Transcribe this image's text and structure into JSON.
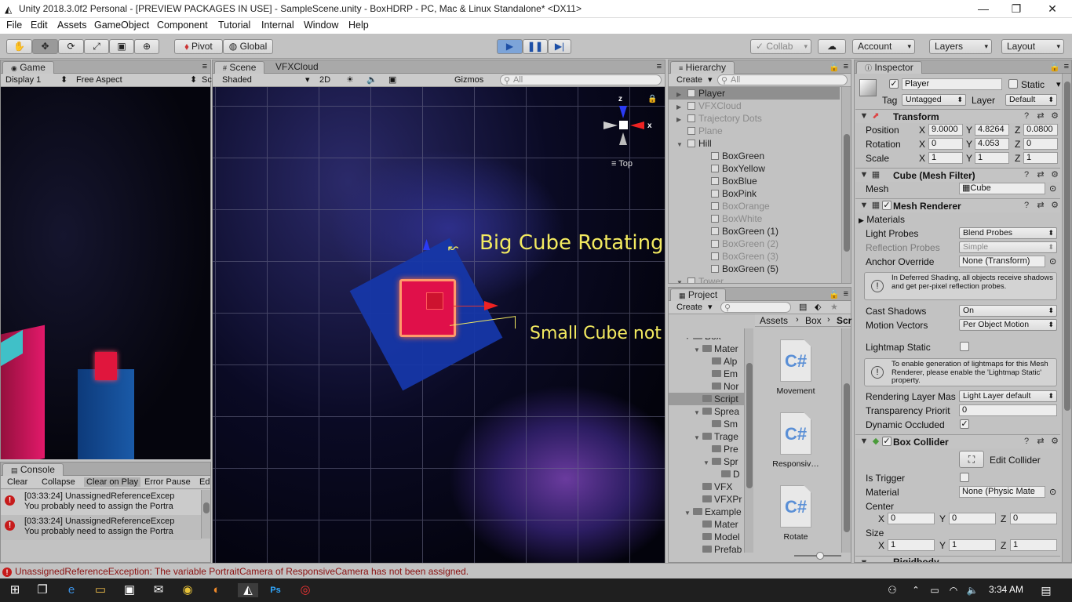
{
  "window": {
    "title": "Unity 2018.3.0f2 Personal - [PREVIEW PACKAGES IN USE] - SampleScene.unity - BoxHDRP - PC, Mac & Linux Standalone* <DX11>",
    "minimize": "—",
    "maximize": "❐",
    "close": "✕"
  },
  "menu": [
    "File",
    "Edit",
    "Assets",
    "GameObject",
    "Component",
    "Tutorial",
    "Internal",
    "Window",
    "Help"
  ],
  "toolbar": {
    "pivot": "Pivot",
    "global": "Global",
    "collab": "Collab",
    "account": "Account",
    "layers": "Layers",
    "layout": "Layout"
  },
  "game": {
    "tab": "Game",
    "display": "Display 1",
    "aspect": "Free Aspect",
    "sc": "Sc"
  },
  "scene": {
    "tab_scene": "Scene",
    "tab_vfx": "VFXCloud",
    "shading": "Shaded",
    "mode2d": "2D",
    "gizmos": "Gizmos",
    "search_placeholder": "All",
    "gizmo_top": "Top",
    "axis_x": "x",
    "axis_z": "z",
    "annotation_big": "Big Cube Rotating",
    "annotation_small": "Small Cube not Rotating"
  },
  "console": {
    "tab": "Console",
    "clear": "Clear",
    "collapse": "Collapse",
    "clear_on_play": "Clear on Play",
    "error_pause": "Error Pause",
    "ed": "Ed",
    "entries": [
      {
        "line1": "[03:33:24] UnassignedReferenceExcep",
        "line2": "You probably need to assign the Portra"
      },
      {
        "line1": "[03:33:24] UnassignedReferenceExcep",
        "line2": "You probably need to assign the Portra"
      }
    ]
  },
  "hierarchy": {
    "tab": "Hierarchy",
    "create": "Create",
    "search": "All",
    "items": [
      {
        "label": "Player",
        "dim": false,
        "indent": 0,
        "arrow": "▶",
        "selected": true
      },
      {
        "label": "VFXCloud",
        "dim": true,
        "indent": 0,
        "arrow": "▶",
        "selected": false
      },
      {
        "label": "Trajectory Dots",
        "dim": true,
        "indent": 0,
        "arrow": "▶",
        "selected": false
      },
      {
        "label": "Plane",
        "dim": true,
        "indent": 0,
        "arrow": "",
        "selected": false
      },
      {
        "label": "Hill",
        "dim": false,
        "indent": 0,
        "arrow": "▼",
        "selected": false
      },
      {
        "label": "BoxGreen",
        "dim": false,
        "indent": 1,
        "arrow": "",
        "selected": false
      },
      {
        "label": "BoxYellow",
        "dim": false,
        "indent": 1,
        "arrow": "",
        "selected": false
      },
      {
        "label": "BoxBlue",
        "dim": false,
        "indent": 1,
        "arrow": "",
        "selected": false
      },
      {
        "label": "BoxPink",
        "dim": false,
        "indent": 1,
        "arrow": "",
        "selected": false
      },
      {
        "label": "BoxOrange",
        "dim": true,
        "indent": 1,
        "arrow": "",
        "selected": false
      },
      {
        "label": "BoxWhite",
        "dim": true,
        "indent": 1,
        "arrow": "",
        "selected": false
      },
      {
        "label": "BoxGreen (1)",
        "dim": false,
        "indent": 1,
        "arrow": "",
        "selected": false
      },
      {
        "label": "BoxGreen (2)",
        "dim": true,
        "indent": 1,
        "arrow": "",
        "selected": false
      },
      {
        "label": "BoxGreen (3)",
        "dim": true,
        "indent": 1,
        "arrow": "",
        "selected": false
      },
      {
        "label": "BoxGreen (5)",
        "dim": false,
        "indent": 1,
        "arrow": "",
        "selected": false
      },
      {
        "label": "Tower",
        "dim": true,
        "indent": 0,
        "arrow": "▼",
        "selected": false
      }
    ]
  },
  "project": {
    "tab": "Project",
    "create": "Create",
    "breadcrumb": [
      "Assets",
      "Box",
      "Scr"
    ],
    "tree": [
      {
        "label": "Box",
        "indent": 0,
        "arrow": "▼",
        "sel": false
      },
      {
        "label": "Mater",
        "indent": 1,
        "arrow": "▼",
        "sel": false
      },
      {
        "label": "Alp",
        "indent": 2,
        "arrow": "",
        "sel": false
      },
      {
        "label": "Em",
        "indent": 2,
        "arrow": "",
        "sel": false
      },
      {
        "label": "Nor",
        "indent": 2,
        "arrow": "",
        "sel": false
      },
      {
        "label": "Script",
        "indent": 1,
        "arrow": "",
        "sel": true
      },
      {
        "label": "Sprea",
        "indent": 1,
        "arrow": "▼",
        "sel": false
      },
      {
        "label": "Sm",
        "indent": 2,
        "arrow": "",
        "sel": false
      },
      {
        "label": "Trage",
        "indent": 1,
        "arrow": "▼",
        "sel": false
      },
      {
        "label": "Pre",
        "indent": 2,
        "arrow": "",
        "sel": false
      },
      {
        "label": "Spr",
        "indent": 2,
        "arrow": "▼",
        "sel": false
      },
      {
        "label": "D",
        "indent": 3,
        "arrow": "",
        "sel": false
      },
      {
        "label": "VFX",
        "indent": 1,
        "arrow": "",
        "sel": false
      },
      {
        "label": "VFXPr",
        "indent": 1,
        "arrow": "",
        "sel": false
      },
      {
        "label": "Example",
        "indent": 0,
        "arrow": "▼",
        "sel": false
      },
      {
        "label": "Mater",
        "indent": 1,
        "arrow": "",
        "sel": false
      },
      {
        "label": "Model",
        "indent": 1,
        "arrow": "",
        "sel": false
      },
      {
        "label": "Prefab",
        "indent": 1,
        "arrow": "",
        "sel": false
      }
    ],
    "assets": [
      {
        "label": "Movement",
        "icon": "C#"
      },
      {
        "label": "Responsiv…",
        "icon": "C#"
      },
      {
        "label": "Rotate",
        "icon": "C#"
      }
    ]
  },
  "inspector": {
    "tab": "Inspector",
    "name": "Player",
    "static": "Static",
    "tag_label": "Tag",
    "tag": "Untagged",
    "layer_label": "Layer",
    "layer": "Default",
    "transform": {
      "title": "Transform",
      "position_label": "Position",
      "rotation_label": "Rotation",
      "scale_label": "Scale",
      "position": [
        "9.0000",
        "4.8264",
        "0.0800"
      ],
      "rotation": [
        "0",
        "4.053",
        "0"
      ],
      "scale": [
        "1",
        "1",
        "1"
      ],
      "x": "X",
      "y": "Y",
      "z": "Z"
    },
    "meshfilter": {
      "title": "Cube (Mesh Filter)",
      "mesh_label": "Mesh",
      "mesh": "Cube"
    },
    "meshrenderer": {
      "title": "Mesh Renderer",
      "materials": "Materials",
      "light_probes_label": "Light Probes",
      "light_probes": "Blend Probes",
      "reflection_label": "Reflection Probes",
      "reflection": "Simple",
      "anchor_label": "Anchor Override",
      "anchor": "None (Transform)",
      "deferred_info": "In Deferred Shading, all objects receive shadows and get per-pixel reflection probes.",
      "cast_label": "Cast Shadows",
      "cast": "On",
      "motion_label": "Motion Vectors",
      "motion": "Per Object Motion",
      "lightmap_label": "Lightmap Static",
      "lightmap_info": "To enable generation of lightmaps for this Mesh Renderer, please enable the 'Lightmap Static' property.",
      "layermask_label": "Rendering Layer Mas",
      "layermask": "Light Layer default",
      "transp_label": "Transparency Priorit",
      "transp": "0",
      "occluded_label": "Dynamic Occluded"
    },
    "boxcollider": {
      "title": "Box Collider",
      "edit": "Edit Collider",
      "trigger_label": "Is Trigger",
      "material_label": "Material",
      "material": "None (Physic Mate",
      "center_label": "Center",
      "center": [
        "0",
        "0",
        "0"
      ],
      "size_label": "Size",
      "size": [
        "1",
        "1",
        "1"
      ]
    },
    "next": "Rigidbody"
  },
  "status": {
    "message": "UnassignedReferenceException: The variable PortraitCamera of ResponsiveCamera has not been assigned."
  },
  "taskbar": {
    "time": "3:34 AM"
  }
}
